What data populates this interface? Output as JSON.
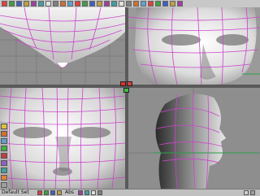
{
  "app": {
    "status_label": "Default Set",
    "status_middle_text": "Abs"
  },
  "viewports": [
    {
      "name": "top",
      "label": ""
    },
    {
      "name": "side",
      "label": ""
    },
    {
      "name": "front",
      "label": ""
    },
    {
      "name": "perspective",
      "label": ""
    }
  ],
  "toolbar": {
    "buttons": [
      "new-icon",
      "open-icon",
      "save-icon",
      "undo-icon",
      "redo-icon",
      "cut-icon",
      "copy-icon",
      "paste-icon",
      "move-icon",
      "rotate-icon",
      "scale-icon",
      "render-icon",
      "lights-icon",
      "camera-icon",
      "materials-icon",
      "grid-icon",
      "snap-icon",
      "select-icon",
      "point-icon",
      "edge-icon",
      "face-icon",
      "mirror-icon",
      "smooth-icon",
      "extrude-icon",
      "help-icon"
    ]
  },
  "colors": {
    "background": "#8e8e8e",
    "wire": "#cc44cc",
    "accent": "#e03030",
    "axis": "#2aa04a"
  }
}
